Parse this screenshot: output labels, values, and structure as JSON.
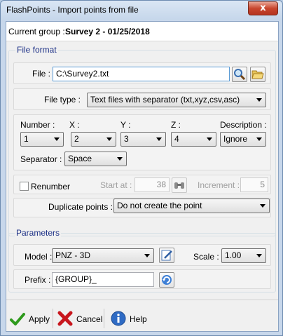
{
  "window": {
    "title": "FlashPoints - Import points from file",
    "close_glyph": "x"
  },
  "header": {
    "group_label": "Current group :",
    "group_value": "Survey 2 - 01/25/2018"
  },
  "file_format": {
    "section_title": "File format",
    "file_label": "File :",
    "file_value": "C:\\Survey2.txt",
    "file_type_label": "File type :",
    "file_type_value": "Text files with separator (txt,xyz,csv,asc)",
    "columns": {
      "number_label": "Number :",
      "number_value": "1",
      "x_label": "X :",
      "x_value": "2",
      "y_label": "Y :",
      "y_value": "3",
      "z_label": "Z :",
      "z_value": "4",
      "description_label": "Description :",
      "description_value": "Ignore"
    },
    "separator_label": "Separator :",
    "separator_value": "Space",
    "renumber_label": "Renumber",
    "renumber_checked": false,
    "start_at_label": "Start at :",
    "start_at_value": "38",
    "increment_label": "Increment :",
    "increment_value": "5",
    "duplicate_label": "Duplicate points :",
    "duplicate_value": "Do not create the point"
  },
  "parameters": {
    "section_title": "Parameters",
    "model_label": "Model :",
    "model_value": "PNZ - 3D",
    "scale_label": "Scale :",
    "scale_value": "1.00",
    "prefix_label": "Prefix :",
    "prefix_value": "{GROUP}_"
  },
  "footer": {
    "apply_label": "Apply",
    "cancel_label": "Cancel",
    "help_label": "Help"
  },
  "icons": {
    "search": "search-icon",
    "folder": "folder-open-icon",
    "binoculars": "binoculars-icon",
    "edit": "edit-icon",
    "refresh": "refresh-icon",
    "apply": "check-icon",
    "cancel": "cross-icon",
    "help": "info-icon"
  },
  "colors": {
    "section_title": "#1e3287",
    "apply_check": "#2e9a1c",
    "cancel_cross": "#c8161d",
    "help_blue": "#2f6bc4"
  }
}
